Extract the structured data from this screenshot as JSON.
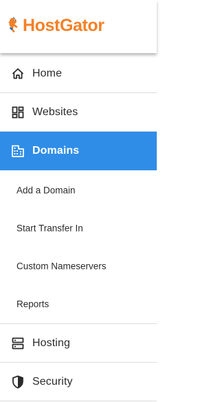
{
  "brand": {
    "name": "HostGator",
    "color": "#f58026",
    "logo_icon": "gator-mascot-icon"
  },
  "nav": {
    "home": {
      "label": "Home",
      "icon": "home-icon"
    },
    "websites": {
      "label": "Websites",
      "icon": "dashboard-grid-icon"
    },
    "domains": {
      "label": "Domains",
      "icon": "building-icon",
      "active": true,
      "children": [
        {
          "label": "Add a Domain"
        },
        {
          "label": "Start Transfer In"
        },
        {
          "label": "Custom Nameservers"
        },
        {
          "label": "Reports"
        }
      ]
    },
    "hosting": {
      "label": "Hosting",
      "icon": "server-icon"
    },
    "security": {
      "label": "Security",
      "icon": "shield-icon"
    }
  },
  "colors": {
    "active_bg": "#2f8de8",
    "text": "#2b2b2b",
    "divider": "#dcdcdc"
  }
}
